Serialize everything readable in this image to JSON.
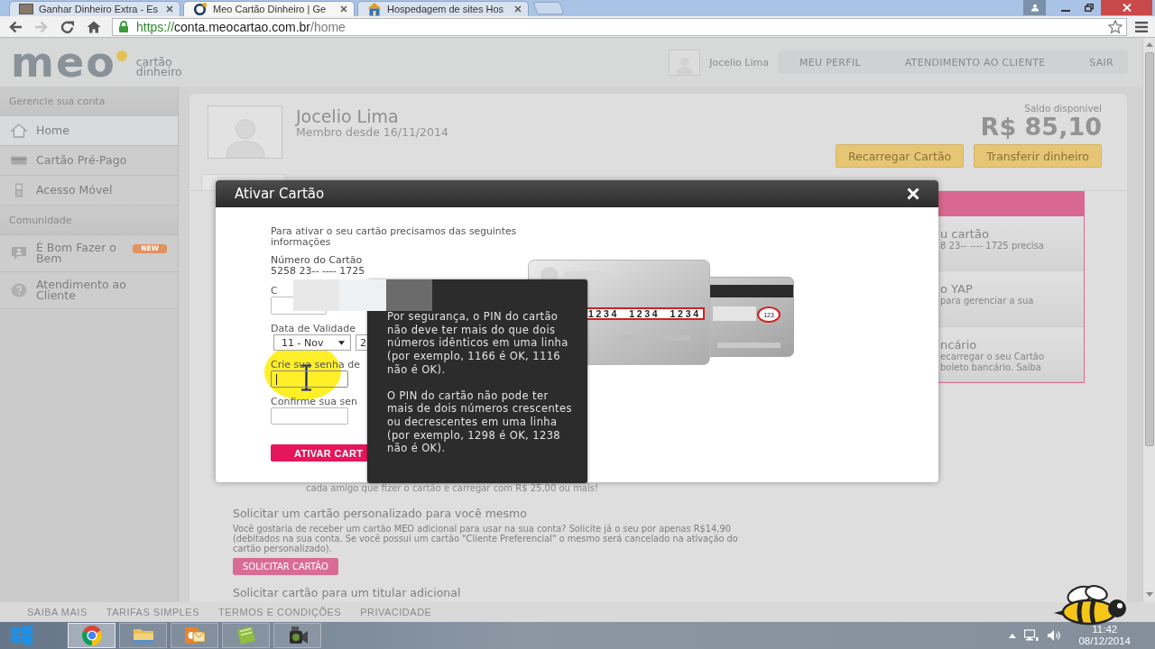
{
  "browser": {
    "tabs": [
      {
        "kind": "photo",
        "title": "Ganhar Dinheiro Extra - Es",
        "selected": false
      },
      {
        "kind": "logo",
        "title": "Meo Cartão Dinheiro | Ge",
        "selected": true
      },
      {
        "kind": "site",
        "title": "Hospedagem de sites Hos",
        "selected": false
      }
    ],
    "nav_buttons": [
      {
        "kind": "back",
        "disabled": false
      },
      {
        "kind": "forward",
        "disabled": true
      },
      {
        "kind": "reload",
        "disabled": false
      },
      {
        "kind": "home",
        "disabled": false
      }
    ],
    "address": {
      "scheme": "https://",
      "host": "conta.meocartao.com.br",
      "path": "/home"
    }
  },
  "header": {
    "logo": {
      "wordmark": "meo",
      "tagline": [
        "cartão",
        "dinheiro"
      ]
    },
    "user_name": "Jocelio Lima",
    "nav": [
      "MEU PERFIL",
      "ATENDIMENTO AO CLIENTE",
      "SAIR"
    ]
  },
  "sidebar": {
    "sections": [
      {
        "title": "Gerencie sua conta",
        "items": [
          {
            "kind": "house",
            "label": "Home",
            "selected": true
          },
          {
            "kind": "card",
            "label": "Cartão Pré-Pago",
            "selected": false
          },
          {
            "kind": "phone",
            "label": "Acesso Móvel",
            "selected": false
          }
        ]
      },
      {
        "title": "Comunidade",
        "items": [
          {
            "kind": "chat",
            "label": "É Bom Fazer o Bem",
            "badge": "NEW",
            "selected": false
          },
          {
            "kind": "help",
            "label": "Atendimento ao Cliente",
            "selected": false
          }
        ]
      }
    ]
  },
  "profile": {
    "name": "Jocelio Lima",
    "member_since": "Membro desde 16/11/2014",
    "balance_label": "Saldo disponivel",
    "balance": "R$ 85,10",
    "actions": [
      "Recarregar Cartão",
      "Transferir dinheiro"
    ]
  },
  "offers": [
    {
      "title": "u cartão",
      "lines": [
        "8 23-- ---- 1725 precisa"
      ]
    },
    {
      "title": "o YAP",
      "lines": [
        "para gerenciar a sua"
      ]
    },
    {
      "title": "ncário",
      "lines": [
        "ecarregar o seu Cartão",
        "boleto bancário. Saiba"
      ]
    }
  ],
  "referral_note": "cada amigo que fizer o cartão e carregar com R$ 25,00 ou mais!",
  "personal_card": {
    "title": "Solicitar um cartão personalizado para você mesmo",
    "text": "Você gostaria de receber um cartão MEO adicional para usar na sua conta? Solicite já o seu por apenas R$14,90 (debitados na sua conta. Se você possui um cartão \"Cliente Preferencial\" o mesmo será cancelado na ativação do cartão personalizado).",
    "button": "SOLICITAR CARTÃO"
  },
  "additional_card": {
    "title": "Solicitar cartão para um titular adicional"
  },
  "footer": {
    "links": [
      "SAIBA MAIS",
      "TARIFAS SIMPLES",
      "TERMOS E CONDIÇÕES",
      "PRIVACIDADE"
    ]
  },
  "modal": {
    "title": "Ativar Cartão",
    "intro": "Para ativar o seu cartão precisamos das seguintes informações",
    "card_number_label": "Número do Cartão",
    "card_number": "5258 23-- ---- 1725",
    "fields": [
      {
        "kind": "text",
        "label": "C",
        "focused": false
      },
      {
        "kind": "date",
        "label": "Data de Validade",
        "selects": [
          "11 - Nov",
          "2"
        ]
      },
      {
        "kind": "password",
        "label": "Crie sua senha de",
        "focused": true
      },
      {
        "kind": "password",
        "label": "Confirme sua sen",
        "focused": false
      }
    ],
    "submit": "ATIVAR CART",
    "card_sample": {
      "number": "1234  1234  1234",
      "code": "123"
    },
    "tooltip": [
      "Por segurança, o PIN do cartão não deve ter mais do que dois números idênticos em uma linha (por exemplo, 1166 é OK, 1116 não é OK).",
      "O PIN do cartão não pode ter mais de dois números crescentes ou decrescentes em uma linha (por exemplo, 1298 é OK, 1238 não é OK)."
    ]
  },
  "taskbar": {
    "apps": [
      {
        "kind": "browser",
        "selected": true
      },
      {
        "kind": "folder",
        "selected": false
      },
      {
        "kind": "mail",
        "selected": false
      },
      {
        "kind": "notebook",
        "selected": false
      },
      {
        "kind": "camera",
        "selected": false
      }
    ],
    "clock": {
      "time": "11:42",
      "date": "08/12/2014"
    }
  }
}
